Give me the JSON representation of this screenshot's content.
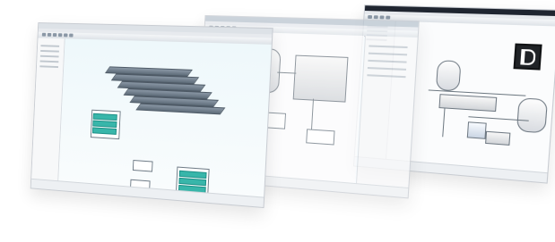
{
  "scene": {
    "theme": "stacked-software-screenshots",
    "colors": {
      "background": "#ffffff",
      "panel_border": "#c8ccd2",
      "accent_teal": "#38b6aa",
      "warning_red": "#c61f1f",
      "logo_dark": "#202327",
      "glass_blue": "#cfe6f8"
    }
  }
}
